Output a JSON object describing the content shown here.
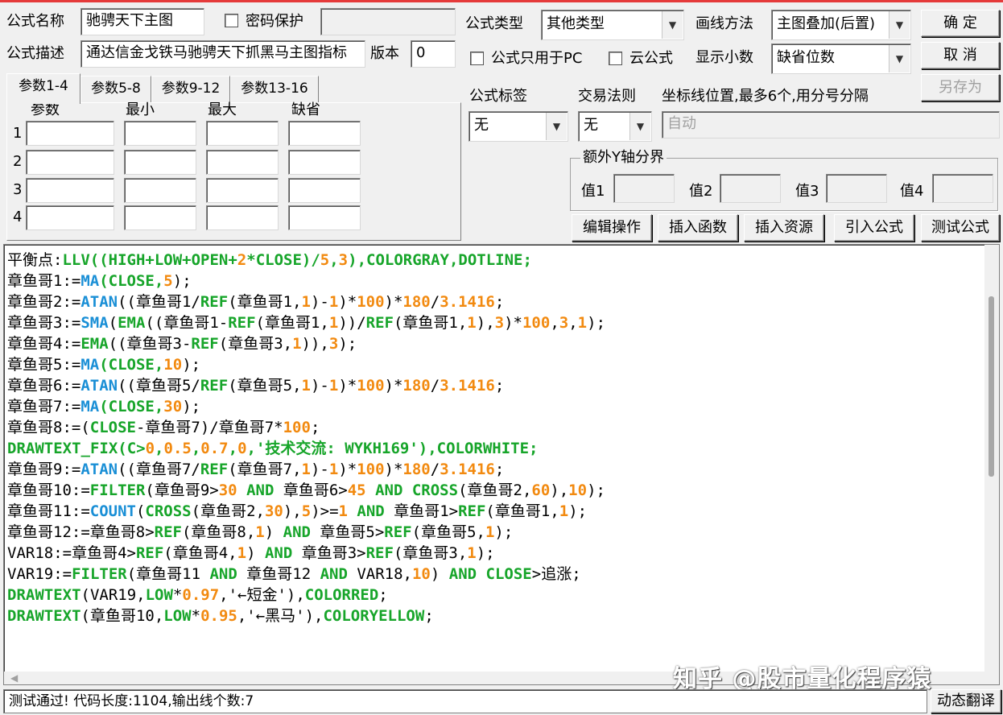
{
  "formula": {
    "name_label": "公式名称",
    "name_value": "驰骋天下主图",
    "password_label": "密码保护",
    "password_value": "",
    "desc_label": "公式描述",
    "desc_value": "通达信金戈铁马驰骋天下抓黑马主图指标",
    "version_label": "版本",
    "version_value": "0"
  },
  "type_panel": {
    "type_label": "公式类型",
    "type_value": "其他类型",
    "draw_label": "画线方法",
    "draw_value": "主图叠加(后置)",
    "pc_only_label": "公式只用于PC",
    "cloud_label": "云公式",
    "decimals_label": "显示小数",
    "decimals_value": "缺省位数",
    "tag_label": "公式标签",
    "tag_value": "无",
    "rule_label": "交易法则",
    "rule_value": "无",
    "coord_label": "坐标线位置,最多6个,用分号分隔",
    "coord_value": "自动"
  },
  "buttons": {
    "ok": "确  定",
    "cancel": "取  消",
    "save_as": "另存为",
    "edit_ops": "编辑操作",
    "insert_func": "插入函数",
    "insert_res": "插入资源",
    "import_formula": "引入公式",
    "test_formula": "测试公式",
    "dynamic_translate": "动态翻译"
  },
  "params": {
    "tabs": [
      "参数1-4",
      "参数5-8",
      "参数9-12",
      "参数13-16"
    ],
    "headers": [
      "参数",
      "最小",
      "最大",
      "缺省"
    ],
    "rows": [
      "1",
      "2",
      "3",
      "4"
    ]
  },
  "yaxis": {
    "title": "额外Y轴分界",
    "labels": [
      "值1",
      "值2",
      "值3",
      "值4"
    ]
  },
  "colors": {
    "keyword": "#17a52a",
    "builtin": "#1a8fd6",
    "number": "#f28a10",
    "text": "#000000"
  },
  "code_lines": [
    [
      [
        "平衡点:",
        "t"
      ],
      [
        "LLV((HIGH+LOW+OPEN+",
        "k"
      ],
      [
        "2",
        "n"
      ],
      [
        "*CLOSE)/",
        "k"
      ],
      [
        "5",
        "n"
      ],
      [
        ",",
        "k"
      ],
      [
        "3",
        "n"
      ],
      [
        "),COLORGRAY,DOTLINE;",
        "k"
      ]
    ],
    [
      [
        "章鱼哥1:=",
        "t"
      ],
      [
        "MA",
        "b"
      ],
      [
        "(CLOSE,",
        "k"
      ],
      [
        "5",
        "n"
      ],
      [
        ");",
        "t"
      ]
    ],
    [
      [
        "章鱼哥2:=",
        "t"
      ],
      [
        "ATAN",
        "b"
      ],
      [
        "((章鱼哥1/",
        "t"
      ],
      [
        "REF",
        "k"
      ],
      [
        "(章鱼哥1,",
        "t"
      ],
      [
        "1",
        "n"
      ],
      [
        ")-",
        "t"
      ],
      [
        "1",
        "n"
      ],
      [
        ")*",
        "t"
      ],
      [
        "100",
        "n"
      ],
      [
        ")*",
        "t"
      ],
      [
        "180",
        "n"
      ],
      [
        "/",
        "t"
      ],
      [
        "3.1416",
        "n"
      ],
      [
        ";",
        "t"
      ]
    ],
    [
      [
        "章鱼哥3:=",
        "t"
      ],
      [
        "SMA",
        "b"
      ],
      [
        "(",
        "t"
      ],
      [
        "EMA",
        "k"
      ],
      [
        "((章鱼哥1-",
        "t"
      ],
      [
        "REF",
        "k"
      ],
      [
        "(章鱼哥1,",
        "t"
      ],
      [
        "1",
        "n"
      ],
      [
        "))/",
        "t"
      ],
      [
        "REF",
        "k"
      ],
      [
        "(章鱼哥1,",
        "t"
      ],
      [
        "1",
        "n"
      ],
      [
        "),",
        "t"
      ],
      [
        "3",
        "n"
      ],
      [
        ")*",
        "t"
      ],
      [
        "100",
        "n"
      ],
      [
        ",",
        "t"
      ],
      [
        "3",
        "n"
      ],
      [
        ",",
        "t"
      ],
      [
        "1",
        "n"
      ],
      [
        ");",
        "t"
      ]
    ],
    [
      [
        "章鱼哥4:=",
        "t"
      ],
      [
        "EMA",
        "k"
      ],
      [
        "((章鱼哥3-",
        "t"
      ],
      [
        "REF",
        "k"
      ],
      [
        "(章鱼哥3,",
        "t"
      ],
      [
        "1",
        "n"
      ],
      [
        ")),",
        "t"
      ],
      [
        "3",
        "n"
      ],
      [
        ");",
        "t"
      ]
    ],
    [
      [
        "章鱼哥5:=",
        "t"
      ],
      [
        "MA",
        "b"
      ],
      [
        "(CLOSE,",
        "k"
      ],
      [
        "10",
        "n"
      ],
      [
        ");",
        "t"
      ]
    ],
    [
      [
        "章鱼哥6:=",
        "t"
      ],
      [
        "ATAN",
        "b"
      ],
      [
        "((章鱼哥5/",
        "t"
      ],
      [
        "REF",
        "k"
      ],
      [
        "(章鱼哥5,",
        "t"
      ],
      [
        "1",
        "n"
      ],
      [
        ")-",
        "t"
      ],
      [
        "1",
        "n"
      ],
      [
        ")*",
        "t"
      ],
      [
        "100",
        "n"
      ],
      [
        ")*",
        "t"
      ],
      [
        "180",
        "n"
      ],
      [
        "/",
        "t"
      ],
      [
        "3.1416",
        "n"
      ],
      [
        ";",
        "t"
      ]
    ],
    [
      [
        "章鱼哥7:=",
        "t"
      ],
      [
        "MA",
        "b"
      ],
      [
        "(CLOSE,",
        "k"
      ],
      [
        "30",
        "n"
      ],
      [
        ");",
        "t"
      ]
    ],
    [
      [
        "章鱼哥8:=(",
        "t"
      ],
      [
        "CLOSE",
        "k"
      ],
      [
        "-章鱼哥7)/章鱼哥7*",
        "t"
      ],
      [
        "100",
        "n"
      ],
      [
        ";",
        "t"
      ]
    ],
    [
      [
        "DRAWTEXT_FIX(C>",
        "k"
      ],
      [
        "0",
        "n"
      ],
      [
        ",",
        "k"
      ],
      [
        "0.5",
        "n"
      ],
      [
        ",",
        "k"
      ],
      [
        "0.7",
        "n"
      ],
      [
        ",",
        "k"
      ],
      [
        "0",
        "n"
      ],
      [
        ",'技术交流: WYKH169'),COLORWHITE;",
        "k"
      ]
    ],
    [
      [
        "章鱼哥9:=",
        "t"
      ],
      [
        "ATAN",
        "b"
      ],
      [
        "((章鱼哥7/",
        "t"
      ],
      [
        "REF",
        "k"
      ],
      [
        "(章鱼哥7,",
        "t"
      ],
      [
        "1",
        "n"
      ],
      [
        ")-",
        "t"
      ],
      [
        "1",
        "n"
      ],
      [
        ")*",
        "t"
      ],
      [
        "100",
        "n"
      ],
      [
        ")*",
        "t"
      ],
      [
        "180",
        "n"
      ],
      [
        "/",
        "t"
      ],
      [
        "3.1416",
        "n"
      ],
      [
        ";",
        "t"
      ]
    ],
    [
      [
        "章鱼哥10:=",
        "t"
      ],
      [
        "FILTER",
        "k"
      ],
      [
        "(章鱼哥9>",
        "t"
      ],
      [
        "30",
        "n"
      ],
      [
        " ",
        "t"
      ],
      [
        "AND",
        "k"
      ],
      [
        " 章鱼哥6>",
        "t"
      ],
      [
        "45",
        "n"
      ],
      [
        " ",
        "t"
      ],
      [
        "AND",
        "k"
      ],
      [
        " ",
        "t"
      ],
      [
        "CROSS",
        "k"
      ],
      [
        "(章鱼哥2,",
        "t"
      ],
      [
        "60",
        "n"
      ],
      [
        "),",
        "t"
      ],
      [
        "10",
        "n"
      ],
      [
        ");",
        "t"
      ]
    ],
    [
      [
        "章鱼哥11:=",
        "t"
      ],
      [
        "COUNT",
        "b"
      ],
      [
        "(",
        "t"
      ],
      [
        "CROSS",
        "k"
      ],
      [
        "(章鱼哥2,",
        "t"
      ],
      [
        "30",
        "n"
      ],
      [
        "),",
        "t"
      ],
      [
        "5",
        "n"
      ],
      [
        ")>=",
        "t"
      ],
      [
        "1",
        "n"
      ],
      [
        " ",
        "t"
      ],
      [
        "AND",
        "k"
      ],
      [
        " 章鱼哥1>",
        "t"
      ],
      [
        "REF",
        "k"
      ],
      [
        "(章鱼哥1,",
        "t"
      ],
      [
        "1",
        "n"
      ],
      [
        ");",
        "t"
      ]
    ],
    [
      [
        "章鱼哥12:=章鱼哥8>",
        "t"
      ],
      [
        "REF",
        "k"
      ],
      [
        "(章鱼哥8,",
        "t"
      ],
      [
        "1",
        "n"
      ],
      [
        ") ",
        "t"
      ],
      [
        "AND",
        "k"
      ],
      [
        " 章鱼哥5>",
        "t"
      ],
      [
        "REF",
        "k"
      ],
      [
        "(章鱼哥5,",
        "t"
      ],
      [
        "1",
        "n"
      ],
      [
        ");",
        "t"
      ]
    ],
    [
      [
        "VAR18:=章鱼哥4>",
        "t"
      ],
      [
        "REF",
        "k"
      ],
      [
        "(章鱼哥4,",
        "t"
      ],
      [
        "1",
        "n"
      ],
      [
        ") ",
        "t"
      ],
      [
        "AND",
        "k"
      ],
      [
        " 章鱼哥3>",
        "t"
      ],
      [
        "REF",
        "k"
      ],
      [
        "(章鱼哥3,",
        "t"
      ],
      [
        "1",
        "n"
      ],
      [
        ");",
        "t"
      ]
    ],
    [
      [
        "VAR19:=",
        "t"
      ],
      [
        "FILTER",
        "k"
      ],
      [
        "(章鱼哥11 ",
        "t"
      ],
      [
        "AND",
        "k"
      ],
      [
        " 章鱼哥12 ",
        "t"
      ],
      [
        "AND",
        "k"
      ],
      [
        " VAR18,",
        "t"
      ],
      [
        "10",
        "n"
      ],
      [
        ") ",
        "t"
      ],
      [
        "AND",
        "k"
      ],
      [
        " ",
        "t"
      ],
      [
        "CLOSE",
        "k"
      ],
      [
        ">追涨;",
        "t"
      ]
    ],
    [
      [
        "DRAWTEXT",
        "k"
      ],
      [
        "(VAR19,",
        "t"
      ],
      [
        "LOW",
        "k"
      ],
      [
        "*",
        "t"
      ],
      [
        "0.97",
        "n"
      ],
      [
        ",'←短金'),",
        "t"
      ],
      [
        "COLORRED",
        "k"
      ],
      [
        ";",
        "t"
      ]
    ],
    [
      [
        "DRAWTEXT",
        "k"
      ],
      [
        "(章鱼哥10,",
        "t"
      ],
      [
        "LOW",
        "k"
      ],
      [
        "*",
        "t"
      ],
      [
        "0.95",
        "n"
      ],
      [
        ",'←黑马'),",
        "t"
      ],
      [
        "COLORYELLOW",
        "k"
      ],
      [
        ";",
        "t"
      ]
    ]
  ],
  "status": "测试通过! 代码长度:1104,输出线个数:7",
  "watermark": "知乎 @股市量化程序猿"
}
